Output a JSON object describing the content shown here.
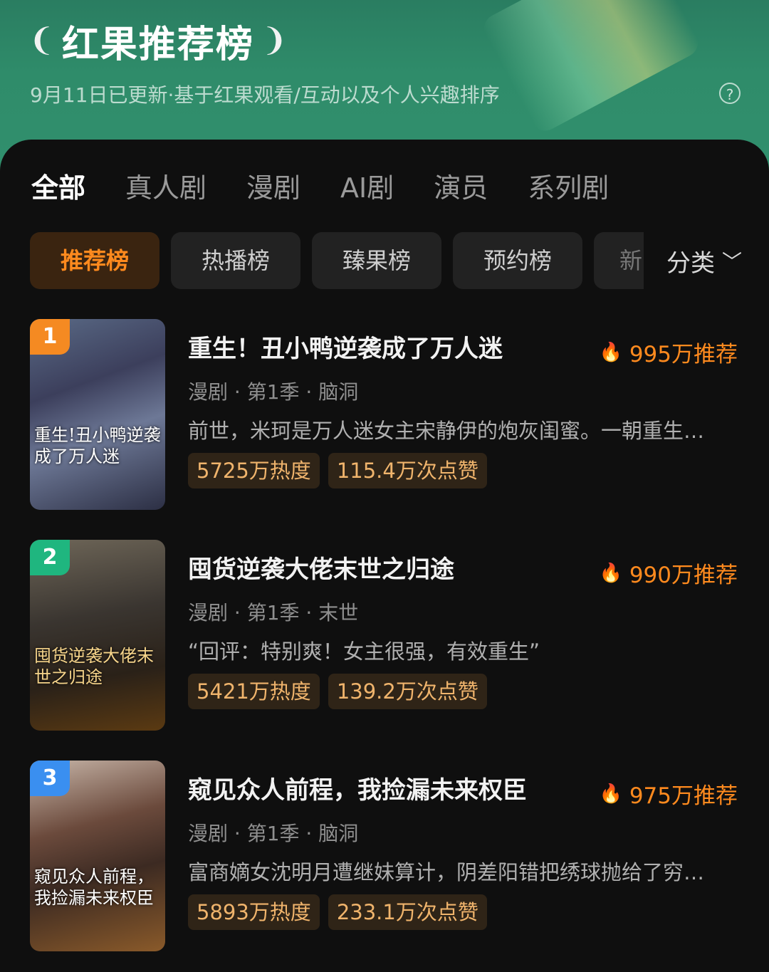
{
  "header": {
    "title": "红果推荐榜",
    "laurel_left": "❨",
    "laurel_right": "❩",
    "subtitle": "9月11日已更新·基于红果观看/互动以及个人兴趣排序",
    "help_glyph": "?"
  },
  "tabs": [
    "全部",
    "真人剧",
    "漫剧",
    "AI剧",
    "演员",
    "系列剧"
  ],
  "chips": [
    "推荐榜",
    "热播榜",
    "臻果榜",
    "预约榜"
  ],
  "chip_partial": "新",
  "category": {
    "label": "分类",
    "icon": "chevron-down-icon",
    "glyph": "﹀"
  },
  "items": [
    {
      "rank": "1",
      "rank_color": "#f58a22",
      "cover_text": "重生!丑小鸭逆袭成了万人迷",
      "name": "重生！丑小鸭逆袭成了万人迷",
      "recommend": "995万推荐",
      "meta": "漫剧 · 第1季 · 脑洞",
      "desc": "前世，米珂是万人迷女主宋静伊的炮灰闺蜜。一朝重生…",
      "heat": "5725万热度",
      "likes": "115.4万次点赞"
    },
    {
      "rank": "2",
      "rank_color": "#1fb67f",
      "cover_text": "囤货逆袭大佬末世之归途",
      "name": "囤货逆袭大佬末世之归途",
      "recommend": "990万推荐",
      "meta": "漫剧 · 第1季 · 末世",
      "desc": "“回评：特别爽！女主很强，有效重生”",
      "heat": "5421万热度",
      "likes": "139.2万次点赞"
    },
    {
      "rank": "3",
      "rank_color": "#3a8ff0",
      "cover_text": "窥见众人前程，我捡漏未来权臣",
      "name": "窥见众人前程，我捡漏未来权臣",
      "recommend": "975万推荐",
      "meta": "漫剧 · 第1季 · 脑洞",
      "desc": "富商嫡女沈明月遭继妹算计，阴差阳错把绣球抛给了穷…",
      "heat": "5893万热度",
      "likes": "233.1万次点赞"
    }
  ],
  "flame_glyph": "🔥",
  "colors": {
    "accent": "#ff8a1e",
    "hero_green": "#2f8c6a",
    "chip_active_bg": "#3a2410",
    "badge_bg": "#2f2417"
  }
}
